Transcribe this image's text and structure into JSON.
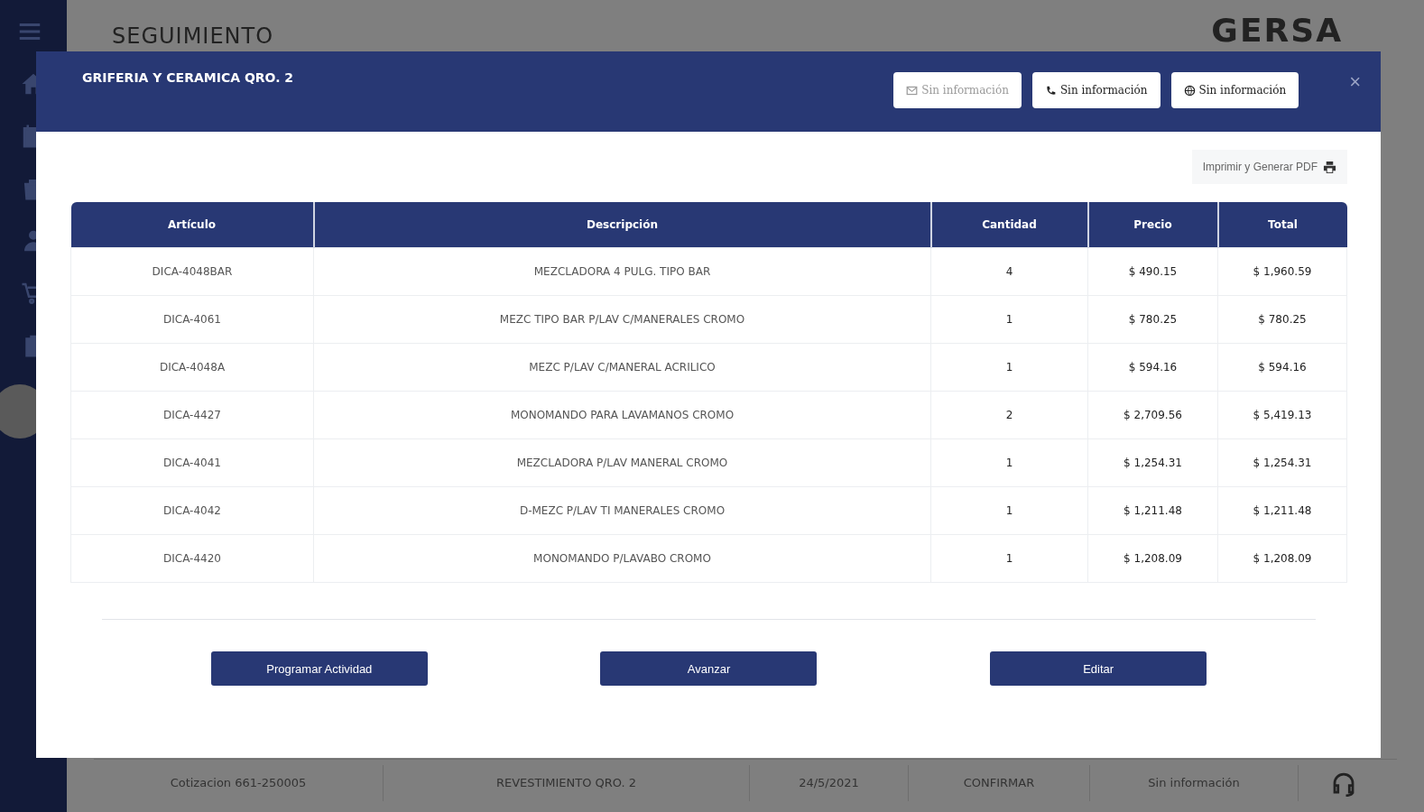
{
  "page": {
    "title": "SEGUIMIENTO",
    "logo": "GERSA",
    "background_row": [
      "Cotizacion 661-250005",
      "REVESTIMIENTO QRO. 2",
      "24/5/2021",
      "CONFIRMAR",
      "Sin información"
    ]
  },
  "modal": {
    "title": "GRIFERIA Y CERAMICA QRO. 2",
    "contact_buttons": [
      {
        "kind": "email",
        "label": "Sin información",
        "disabled": true
      },
      {
        "kind": "phone",
        "label": "Sin información",
        "disabled": false
      },
      {
        "kind": "web",
        "label": "Sin información",
        "disabled": false
      }
    ],
    "close": "×",
    "print_button": "Imprimir y Generar PDF",
    "table": {
      "columns": [
        "Artículo",
        "Descripción",
        "Cantidad",
        "Precio",
        "Total"
      ],
      "rows": [
        [
          "DICA-4048BAR",
          "MEZCLADORA 4 PULG. TIPO BAR",
          "4",
          "$ 490.15",
          "$ 1,960.59"
        ],
        [
          "DICA-4061",
          "MEZC TIPO BAR P/LAV C/MANERALES CROMO",
          "1",
          "$ 780.25",
          "$ 780.25"
        ],
        [
          "DICA-4048A",
          "MEZC P/LAV C/MANERAL ACRILICO",
          "1",
          "$ 594.16",
          "$ 594.16"
        ],
        [
          "DICA-4427",
          "MONOMANDO PARA LAVAMANOS CROMO",
          "2",
          "$ 2,709.56",
          "$ 5,419.13"
        ],
        [
          "DICA-4041",
          "MEZCLADORA P/LAV MANERAL CROMO",
          "1",
          "$ 1,254.31",
          "$ 1,254.31"
        ],
        [
          "DICA-4042",
          "D-MEZC P/LAV TI MANERALES CROMO",
          "1",
          "$ 1,211.48",
          "$ 1,211.48"
        ],
        [
          "DICA-4420",
          "MONOMANDO P/LAVABO CROMO",
          "1",
          "$ 1,208.09",
          "$ 1,208.09"
        ]
      ]
    },
    "actions": [
      "Programar Actividad",
      "Avanzar",
      "Editar"
    ]
  }
}
